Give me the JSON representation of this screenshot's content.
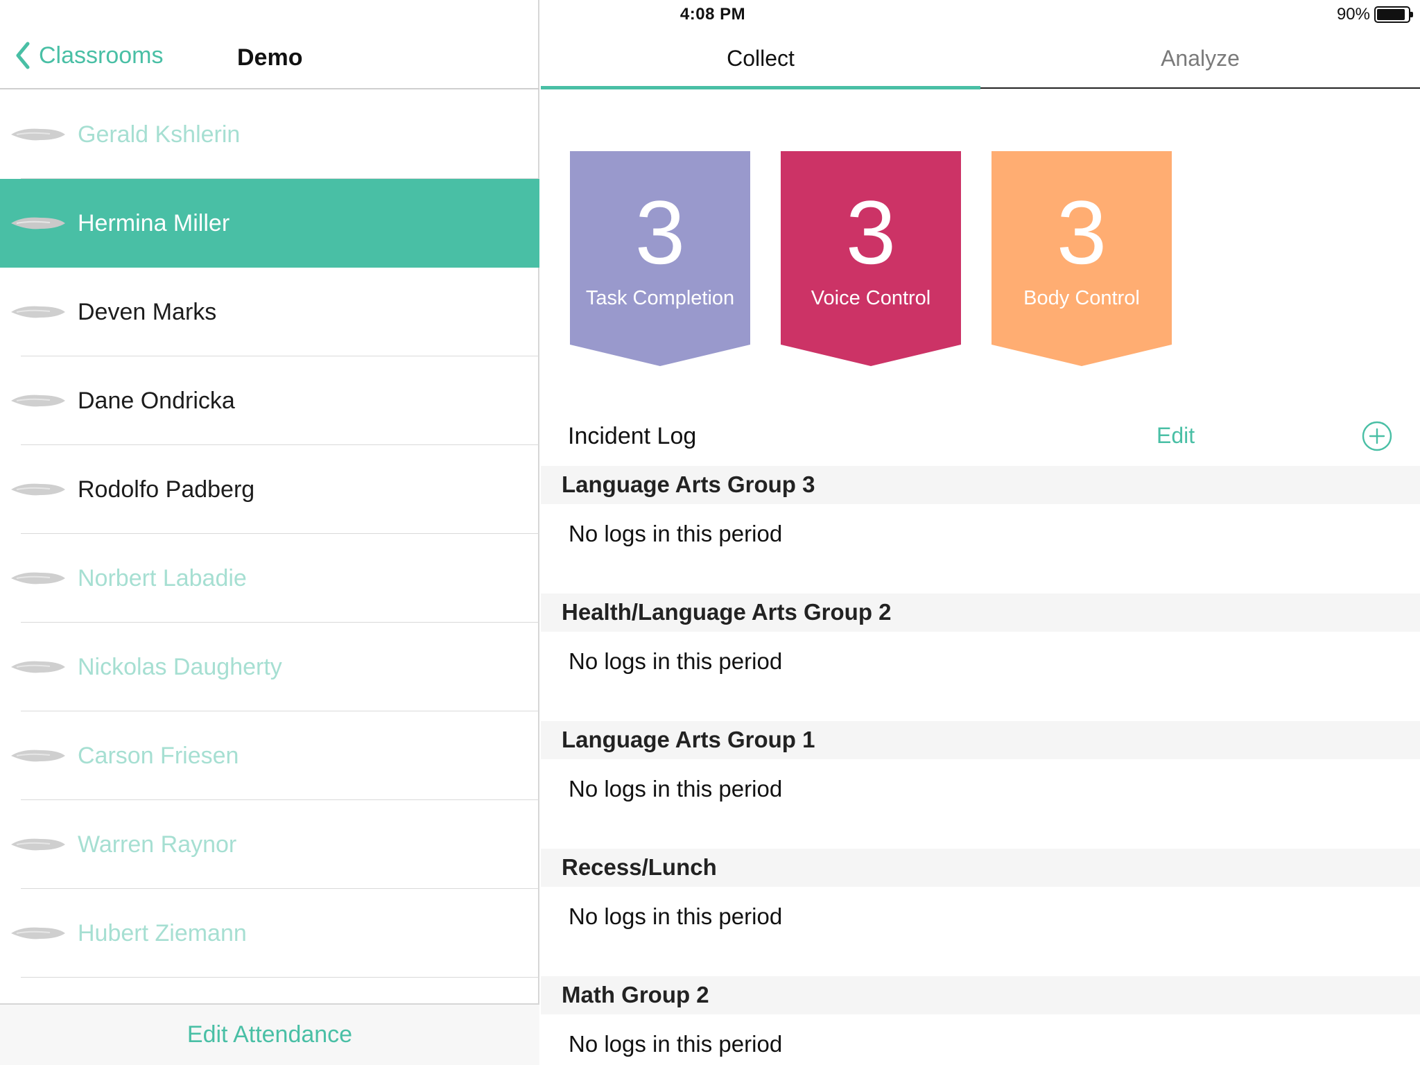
{
  "status_bar": {
    "device": "iPad",
    "time": "4:08 PM",
    "battery_text": "90%",
    "battery_level": 0.9
  },
  "nav": {
    "back_label": "Classrooms",
    "title": "Demo"
  },
  "students": [
    {
      "name": "Gerald Kshlerin",
      "state": "absent"
    },
    {
      "name": "Hermina Miller",
      "state": "selected"
    },
    {
      "name": "Deven Marks",
      "state": "present"
    },
    {
      "name": "Dane Ondricka",
      "state": "present"
    },
    {
      "name": "Rodolfo Padberg",
      "state": "present"
    },
    {
      "name": "Norbert Labadie",
      "state": "absent"
    },
    {
      "name": "Nickolas Daugherty",
      "state": "absent"
    },
    {
      "name": "Carson Friesen",
      "state": "absent"
    },
    {
      "name": "Warren Raynor",
      "state": "absent"
    },
    {
      "name": "Hubert Ziemann",
      "state": "absent"
    }
  ],
  "bottom": {
    "edit_attendance": "Edit Attendance"
  },
  "tabs": {
    "collect": "Collect",
    "analyze": "Analyze",
    "active": "collect"
  },
  "badges": [
    {
      "count": "3",
      "label": "Task Completion",
      "color": "#9999cc"
    },
    {
      "count": "3",
      "label": "Voice Control",
      "color": "#cc3366"
    },
    {
      "count": "3",
      "label": "Body Control",
      "color": "#ffad72"
    }
  ],
  "incident_log": {
    "title": "Incident Log",
    "edit_label": "Edit"
  },
  "groups": [
    {
      "title": "Language Arts Group 3",
      "empty_text": "No logs in this period"
    },
    {
      "title": "Health/Language Arts Group 2",
      "empty_text": "No logs in this period"
    },
    {
      "title": "Language Arts Group 1",
      "empty_text": "No logs in this period"
    },
    {
      "title": "Recess/Lunch",
      "empty_text": "No logs in this period"
    },
    {
      "title": "Math Group 2",
      "empty_text": "No logs in this period"
    }
  ],
  "colors": {
    "accent": "#49bfa5",
    "absent_text": "#a6dfd2"
  },
  "icons": {
    "back": "chevron-left-icon",
    "wifi": "wifi-icon",
    "battery": "battery-icon",
    "add": "plus-circle-icon",
    "avatar": "avatar-placeholder-icon"
  }
}
